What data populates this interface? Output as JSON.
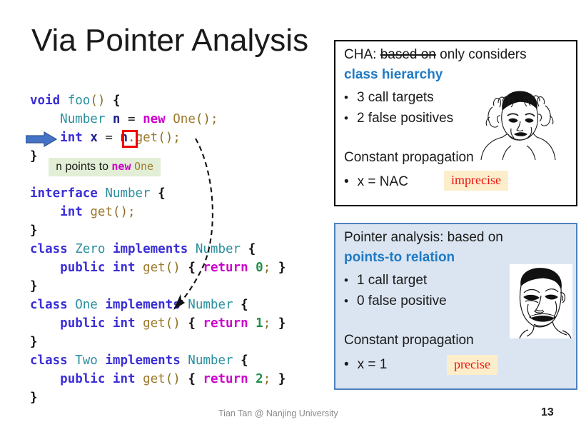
{
  "slide": {
    "title": "Via Pointer Analysis",
    "page_number": "13",
    "footer": "Tian Tan @ Nanjing University"
  },
  "code": {
    "lines": [
      [
        {
          "t": "void",
          "c": "kw"
        },
        {
          "t": " ",
          "c": "plain"
        },
        {
          "t": "foo",
          "c": "type"
        },
        {
          "t": "()",
          "c": "punc"
        },
        {
          "t": " ",
          "c": "plain"
        },
        {
          "t": "{",
          "c": "brace"
        }
      ],
      [
        {
          "t": "    ",
          "c": "plain"
        },
        {
          "t": "Number",
          "c": "type"
        },
        {
          "t": " ",
          "c": "plain"
        },
        {
          "t": "n",
          "c": "var"
        },
        {
          "t": " ",
          "c": "plain"
        },
        {
          "t": "=",
          "c": "plain"
        },
        {
          "t": " ",
          "c": "plain"
        },
        {
          "t": "new",
          "c": "newkw"
        },
        {
          "t": " ",
          "c": "plain"
        },
        {
          "t": "One",
          "c": "ctor"
        },
        {
          "t": "()",
          "c": "punc"
        },
        {
          "t": ";",
          "c": "punc"
        }
      ],
      [
        {
          "t": "    ",
          "c": "plain"
        },
        {
          "t": "int",
          "c": "kw"
        },
        {
          "t": " ",
          "c": "plain"
        },
        {
          "t": "x",
          "c": "var"
        },
        {
          "t": " ",
          "c": "plain"
        },
        {
          "t": "=",
          "c": "plain"
        },
        {
          "t": " ",
          "c": "plain"
        },
        {
          "t": "n",
          "c": "var"
        },
        {
          "t": ".",
          "c": "punc"
        },
        {
          "t": "get",
          "c": "ctor"
        },
        {
          "t": "()",
          "c": "punc"
        },
        {
          "t": ";",
          "c": "punc"
        }
      ],
      [
        {
          "t": "}",
          "c": "brace"
        }
      ],
      [
        {
          "t": "",
          "c": "plain"
        }
      ],
      [
        {
          "t": "interface",
          "c": "kw"
        },
        {
          "t": " ",
          "c": "plain"
        },
        {
          "t": "Number",
          "c": "type"
        },
        {
          "t": " ",
          "c": "plain"
        },
        {
          "t": "{",
          "c": "brace"
        }
      ],
      [
        {
          "t": "    ",
          "c": "plain"
        },
        {
          "t": "int",
          "c": "kw"
        },
        {
          "t": " ",
          "c": "plain"
        },
        {
          "t": "get",
          "c": "ctor"
        },
        {
          "t": "()",
          "c": "punc"
        },
        {
          "t": ";",
          "c": "punc"
        }
      ],
      [
        {
          "t": "}",
          "c": "brace"
        }
      ],
      [
        {
          "t": "class",
          "c": "kw"
        },
        {
          "t": " ",
          "c": "plain"
        },
        {
          "t": "Zero",
          "c": "type"
        },
        {
          "t": " ",
          "c": "plain"
        },
        {
          "t": "implements",
          "c": "kw"
        },
        {
          "t": " ",
          "c": "plain"
        },
        {
          "t": "Number",
          "c": "type"
        },
        {
          "t": " ",
          "c": "plain"
        },
        {
          "t": "{",
          "c": "brace"
        }
      ],
      [
        {
          "t": "    ",
          "c": "plain"
        },
        {
          "t": "public",
          "c": "kw"
        },
        {
          "t": " ",
          "c": "plain"
        },
        {
          "t": "int",
          "c": "kw"
        },
        {
          "t": " ",
          "c": "plain"
        },
        {
          "t": "get",
          "c": "ctor"
        },
        {
          "t": "()",
          "c": "punc"
        },
        {
          "t": " ",
          "c": "plain"
        },
        {
          "t": "{",
          "c": "brace"
        },
        {
          "t": " ",
          "c": "plain"
        },
        {
          "t": "return",
          "c": "newkw"
        },
        {
          "t": " ",
          "c": "plain"
        },
        {
          "t": "0",
          "c": "num"
        },
        {
          "t": ";",
          "c": "punc"
        },
        {
          "t": " ",
          "c": "plain"
        },
        {
          "t": "}",
          "c": "brace"
        }
      ],
      [
        {
          "t": "}",
          "c": "brace"
        }
      ],
      [
        {
          "t": "class",
          "c": "kw"
        },
        {
          "t": " ",
          "c": "plain"
        },
        {
          "t": "One",
          "c": "type"
        },
        {
          "t": " ",
          "c": "plain"
        },
        {
          "t": "implements",
          "c": "kw"
        },
        {
          "t": " ",
          "c": "plain"
        },
        {
          "t": "Number",
          "c": "type"
        },
        {
          "t": " ",
          "c": "plain"
        },
        {
          "t": "{",
          "c": "brace"
        }
      ],
      [
        {
          "t": "    ",
          "c": "plain"
        },
        {
          "t": "public",
          "c": "kw"
        },
        {
          "t": " ",
          "c": "plain"
        },
        {
          "t": "int",
          "c": "kw"
        },
        {
          "t": " ",
          "c": "plain"
        },
        {
          "t": "get",
          "c": "ctor"
        },
        {
          "t": "()",
          "c": "punc"
        },
        {
          "t": " ",
          "c": "plain"
        },
        {
          "t": "{",
          "c": "brace"
        },
        {
          "t": " ",
          "c": "plain"
        },
        {
          "t": "return",
          "c": "newkw"
        },
        {
          "t": " ",
          "c": "plain"
        },
        {
          "t": "1",
          "c": "num"
        },
        {
          "t": ";",
          "c": "punc"
        },
        {
          "t": " ",
          "c": "plain"
        },
        {
          "t": "}",
          "c": "brace"
        }
      ],
      [
        {
          "t": "}",
          "c": "brace"
        }
      ],
      [
        {
          "t": "class",
          "c": "kw"
        },
        {
          "t": " ",
          "c": "plain"
        },
        {
          "t": "Two",
          "c": "type"
        },
        {
          "t": " ",
          "c": "plain"
        },
        {
          "t": "implements",
          "c": "kw"
        },
        {
          "t": " ",
          "c": "plain"
        },
        {
          "t": "Number",
          "c": "type"
        },
        {
          "t": " ",
          "c": "plain"
        },
        {
          "t": "{",
          "c": "brace"
        }
      ],
      [
        {
          "t": "    ",
          "c": "plain"
        },
        {
          "t": "public",
          "c": "kw"
        },
        {
          "t": " ",
          "c": "plain"
        },
        {
          "t": "int",
          "c": "kw"
        },
        {
          "t": " ",
          "c": "plain"
        },
        {
          "t": "get",
          "c": "ctor"
        },
        {
          "t": "()",
          "c": "punc"
        },
        {
          "t": " ",
          "c": "plain"
        },
        {
          "t": "{",
          "c": "brace"
        },
        {
          "t": " ",
          "c": "plain"
        },
        {
          "t": "return",
          "c": "newkw"
        },
        {
          "t": " ",
          "c": "plain"
        },
        {
          "t": "2",
          "c": "num"
        },
        {
          "t": ";",
          "c": "punc"
        },
        {
          "t": " ",
          "c": "plain"
        },
        {
          "t": "}",
          "c": "brace"
        }
      ],
      [
        {
          "t": "}",
          "c": "brace"
        }
      ]
    ]
  },
  "annotation": {
    "prefix": "n",
    "middle": " points to ",
    "new_kw": "new",
    "type_name": "One"
  },
  "cha_panel": {
    "head_prefix": "CHA: ",
    "head_struck": "based on",
    "head_suffix": " only considers",
    "subtitle": "class hierarchy",
    "bullets": [
      "3 call targets",
      "2 false positives"
    ],
    "bullet_marker": "•",
    "section": "Constant propagation",
    "result": "x = NAC",
    "tag": "imprecise",
    "meme": "jackie-chan-confused-meme"
  },
  "pta_panel": {
    "head": "Pointer analysis: based on",
    "subtitle": "points-to relation",
    "bullets": [
      "1 call target",
      "0 false positive"
    ],
    "bullet_marker": "•",
    "section": "Constant propagation",
    "result": "x = 1",
    "tag": "precise",
    "meme": "yao-ming-face-meme"
  },
  "colors": {
    "accent_blue": "#1f7ac4",
    "panel_blue_fill": "#dbe5f1",
    "panel_blue_border": "#4f81bd",
    "tag_bg": "#fdeecb",
    "tag_text": "#ee1111",
    "annotation_bg": "#e2eed5",
    "highlight_red": "#ee0000",
    "arrow_blue": "#4472c4"
  }
}
